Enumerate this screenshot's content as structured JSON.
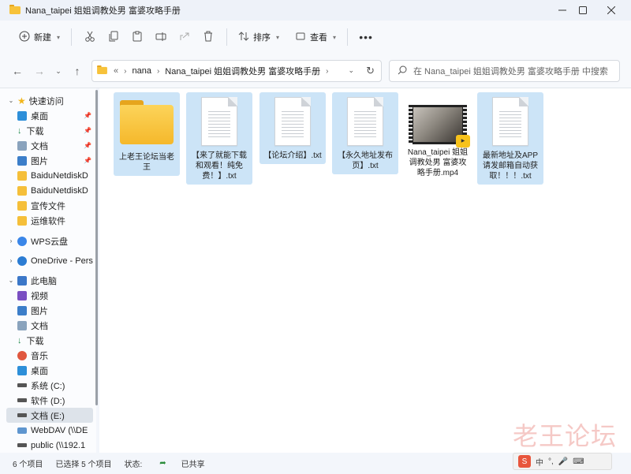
{
  "window": {
    "title": "Nana_taipei 姐姐调教处男 富婆攻略手册"
  },
  "toolbar": {
    "new_label": "新建",
    "sort_label": "排序",
    "view_label": "查看"
  },
  "address": {
    "overflow": "«",
    "crumbs": [
      "nana",
      "Nana_taipei 姐姐调教处男 富婆攻略手册"
    ]
  },
  "search": {
    "placeholder": "在 Nana_taipei 姐姐调教处男 富婆攻略手册 中搜索"
  },
  "sidebar": {
    "items": [
      {
        "label": "快速访问"
      },
      {
        "label": "桌面"
      },
      {
        "label": "下载"
      },
      {
        "label": "文档"
      },
      {
        "label": "图片"
      },
      {
        "label": "BaiduNetdiskD"
      },
      {
        "label": "BaiduNetdiskD"
      },
      {
        "label": "宣传文件"
      },
      {
        "label": "运维软件"
      },
      {
        "label": "WPS云盘"
      },
      {
        "label": "OneDrive - Pers"
      },
      {
        "label": "此电脑"
      },
      {
        "label": "视频"
      },
      {
        "label": "图片"
      },
      {
        "label": "文档"
      },
      {
        "label": "下载"
      },
      {
        "label": "音乐"
      },
      {
        "label": "桌面"
      },
      {
        "label": "系统 (C:)"
      },
      {
        "label": "软件 (D:)"
      },
      {
        "label": "文档 (E:)"
      },
      {
        "label": "WebDAV (\\\\DE"
      },
      {
        "label": "public (\\\\192.1"
      }
    ]
  },
  "files": [
    {
      "name": "上老王论坛当老王",
      "kind": "folder"
    },
    {
      "name": "【来了就能下载和观看！纯免费！】.txt",
      "kind": "text"
    },
    {
      "name": "【论坛介绍】.txt",
      "kind": "text"
    },
    {
      "name": "【永久地址发布页】.txt",
      "kind": "text"
    },
    {
      "name": "Nana_taipei 姐姐调教处男 富婆攻略手册.mp4",
      "kind": "video"
    },
    {
      "name": "最新地址及APP请发邮箱自动获取！！！.txt",
      "kind": "text"
    }
  ],
  "status": {
    "count": "6 个项目",
    "selected": "已选择 5 个项目",
    "state_label": "状态:",
    "state_value": "已共享"
  },
  "watermark": "老王论坛",
  "ime": {
    "label": "中"
  },
  "colors": {
    "selection": "#cce4f7",
    "folder": "#f5b82b",
    "accent": "#0a64c8"
  }
}
